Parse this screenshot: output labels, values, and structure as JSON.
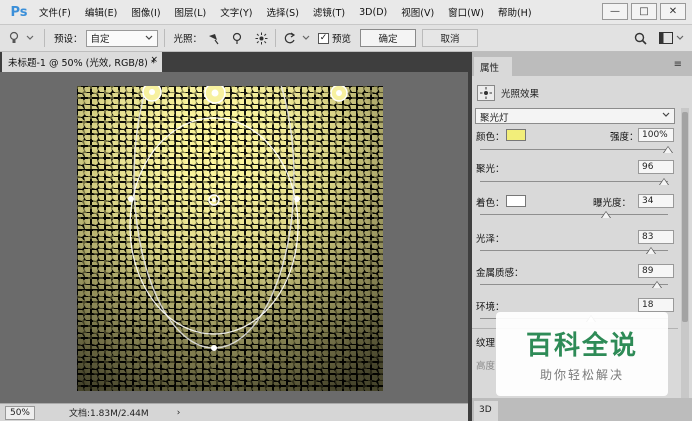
{
  "app": {
    "logo": "Ps"
  },
  "menu": [
    "文件(F)",
    "编辑(E)",
    "图像(I)",
    "图层(L)",
    "文字(Y)",
    "选择(S)",
    "滤镜(T)",
    "3D(D)",
    "视图(V)",
    "窗口(W)",
    "帮助(H)"
  ],
  "window_controls": {
    "minimize": "—",
    "maximize": "□",
    "close": "✕"
  },
  "options": {
    "preset_label": "预设：",
    "preset_value": "自定",
    "lights_label": "光照：",
    "preview_label": "预览",
    "preview_checked": true,
    "ok_label": "确定",
    "cancel_label": "取消"
  },
  "document": {
    "tab_title": "未标题-1 @ 50% (光效, RGB/8) *",
    "close_glyph": "×"
  },
  "status": {
    "zoom": "50%",
    "doc_info": "文档:1.83M/2.44M",
    "arrow": "›"
  },
  "panel": {
    "title": "属性",
    "filter_name": "光照效果",
    "light_type": "聚光灯",
    "color_label": "颜色：",
    "intensity_label": "强度：",
    "intensity_value": "100%",
    "hotspot_label": "聚光：",
    "hotspot_value": "96",
    "colorize_label": "着色：",
    "exposure_label": "曝光度：",
    "exposure_value": "34",
    "gloss_label": "光泽：",
    "gloss_value": "83",
    "metallic_label": "金属质感：",
    "metallic_value": "89",
    "ambience_label": "环境：",
    "ambience_value": "18",
    "texture_label": "纹理",
    "height_label": "高度",
    "bottom_tab": "3D",
    "light_color": "#f2ee7a",
    "colorize_color": "#ffffff",
    "slider_levels": {
      "intensity": 1.0,
      "hotspot": 0.98,
      "exposure": 0.67,
      "gloss": 0.91,
      "metallic": 0.94,
      "ambience": 0.59
    }
  },
  "watermark": {
    "big": "百科全说",
    "small": "助你轻松解决"
  }
}
